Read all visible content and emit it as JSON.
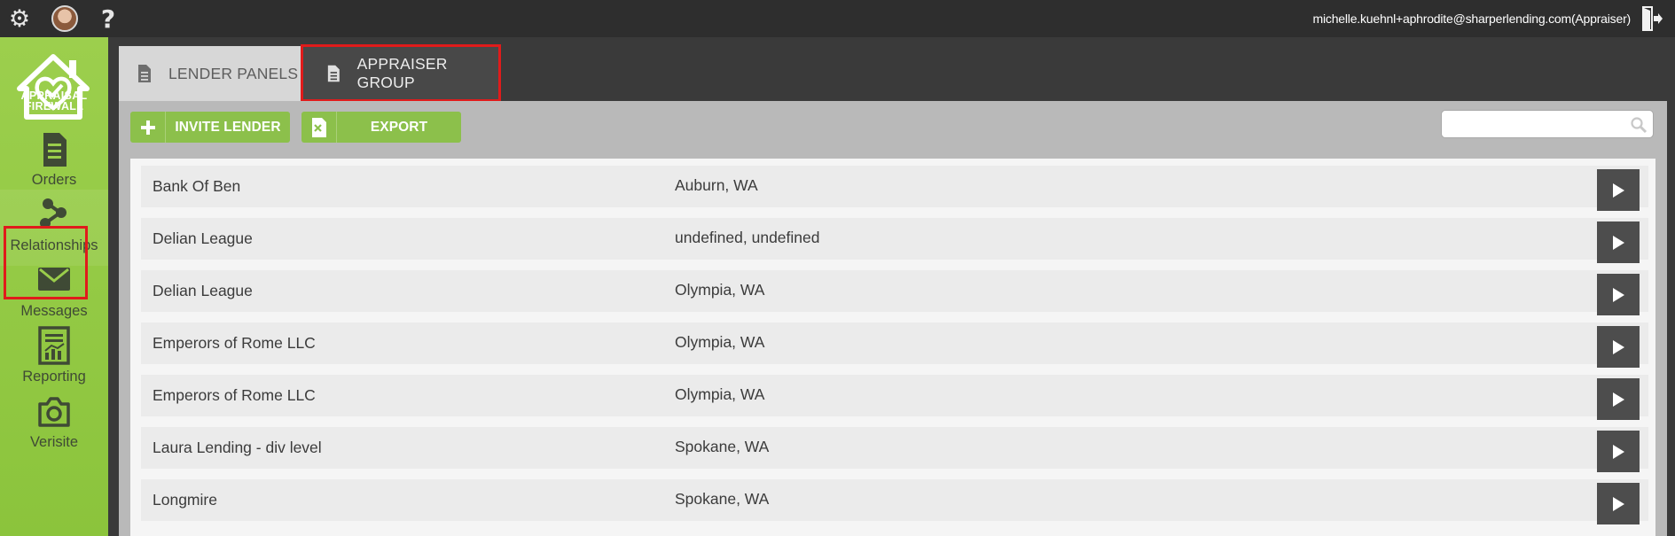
{
  "header": {
    "settings_icon": "gear-icon",
    "avatar_icon": "user-avatar",
    "help_label": "?",
    "user_label": "michelle.kuehnl+aphrodite@sharperlending.com(Appraiser)",
    "logout_icon": "logout-door-icon"
  },
  "sidebar": {
    "logo_line1": "APPRAISAL",
    "logo_line2": "FIREWALL",
    "items": [
      {
        "label": "Orders",
        "icon": "document-icon"
      },
      {
        "label": "Relationships",
        "icon": "relationship-nodes-icon"
      },
      {
        "label": "Messages",
        "icon": "envelope-icon"
      },
      {
        "label": "Reporting",
        "icon": "report-chart-icon"
      },
      {
        "label": "Verisite",
        "icon": "camera-icon"
      }
    ]
  },
  "tabs": [
    {
      "label": "LENDER PANELS",
      "icon": "document-icon"
    },
    {
      "label": "APPRAISER GROUP",
      "icon": "document-icon"
    }
  ],
  "toolbar": {
    "invite_label": "INVITE LENDER",
    "export_label": "EXPORT",
    "search_placeholder": "",
    "search_value": ""
  },
  "lenders": [
    {
      "name": "Bank Of Ben",
      "location": "Auburn, WA"
    },
    {
      "name": "Delian League",
      "location": "undefined, undefined"
    },
    {
      "name": "Delian League",
      "location": "Olympia, WA"
    },
    {
      "name": "Emperors of Rome LLC",
      "location": "Olympia, WA"
    },
    {
      "name": "Emperors of Rome LLC",
      "location": "Olympia, WA"
    },
    {
      "name": "Laura Lending - div level",
      "location": "Spokane, WA"
    },
    {
      "name": "Longmire",
      "location": "Spokane, WA"
    }
  ],
  "colors": {
    "accent_green": "#8cc63f",
    "highlight_red": "#e01b1b",
    "topbar": "#2e2e2e"
  }
}
